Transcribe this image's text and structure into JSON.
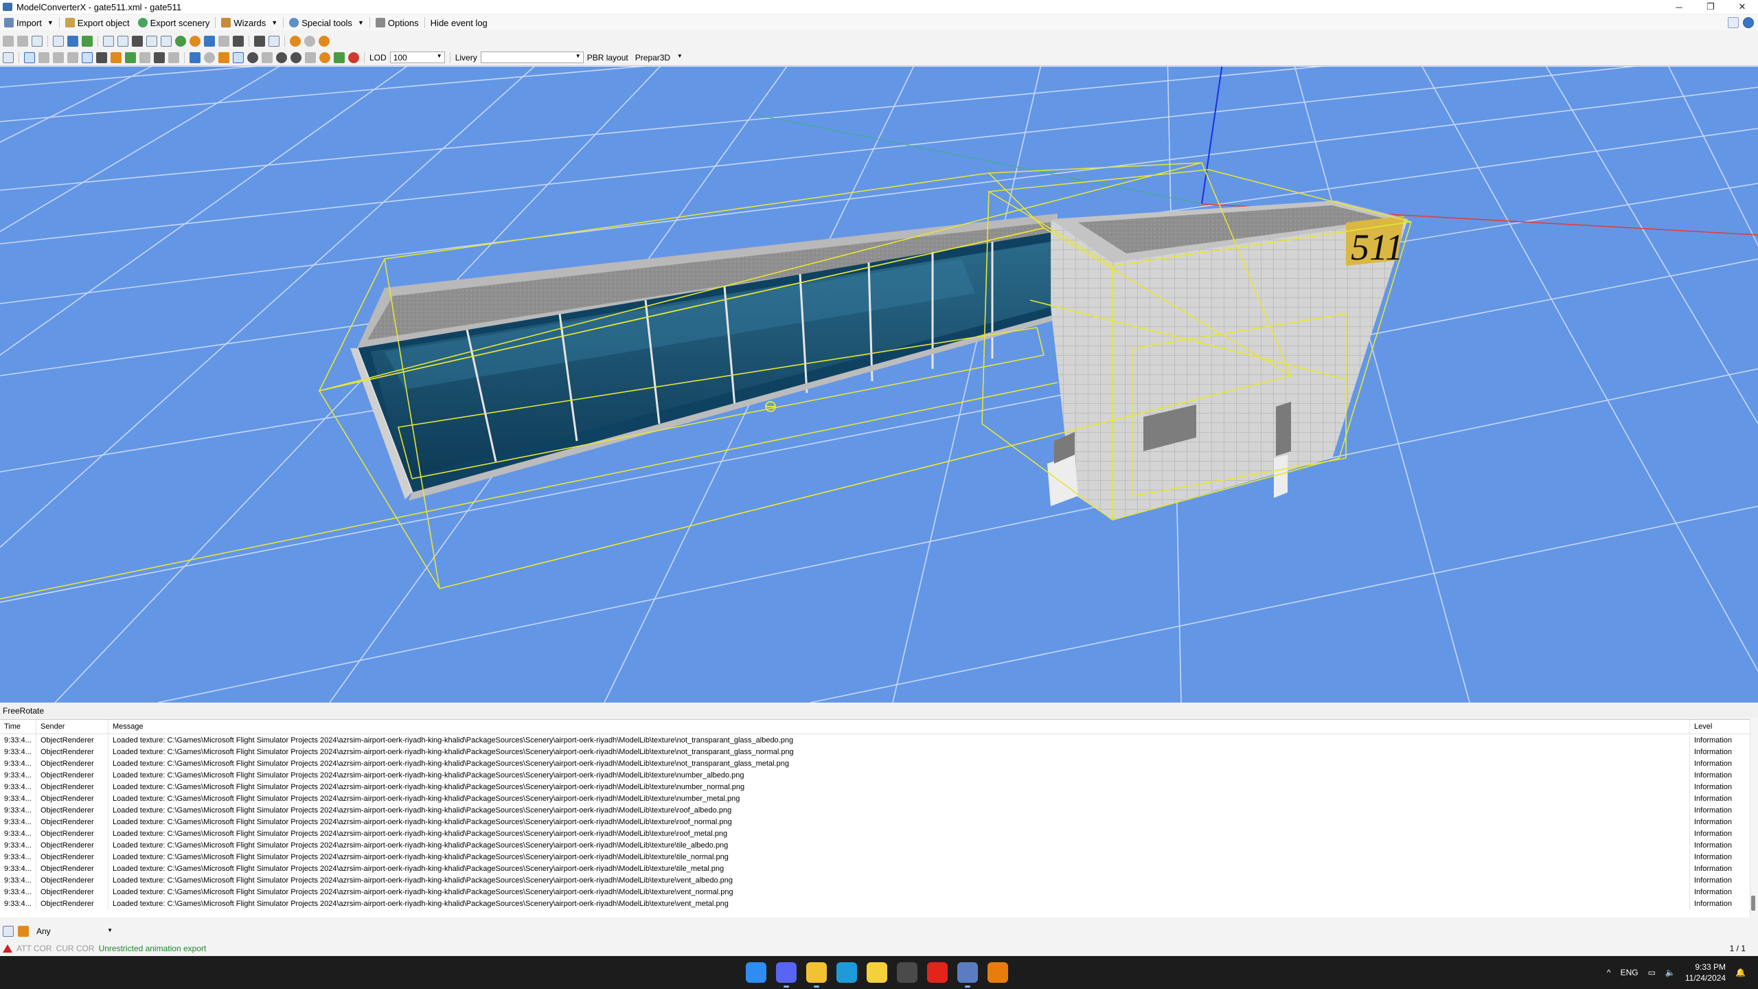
{
  "window": {
    "title": "ModelConverterX - gate511.xml - gate511",
    "controls": [
      "─",
      "❐",
      "✕"
    ]
  },
  "menubar": {
    "items": [
      {
        "label": "Import",
        "icon": "import-icon",
        "has_dropdown": true
      },
      {
        "label": "Export object",
        "icon": "export-object-icon",
        "has_dropdown": false
      },
      {
        "label": "Export scenery",
        "icon": "export-scenery-icon",
        "has_dropdown": false
      },
      {
        "label": "Wizards",
        "icon": "wizard-icon",
        "has_dropdown": true
      },
      {
        "label": "Special tools",
        "icon": "special-tools-icon",
        "has_dropdown": true
      },
      {
        "label": "Options",
        "icon": "options-icon",
        "has_dropdown": false
      },
      {
        "label": "Hide event log",
        "icon": "",
        "has_dropdown": false
      }
    ]
  },
  "toolbar2": {
    "lod_label": "LOD",
    "lod_value": "100",
    "livery_label": "Livery",
    "livery_value": "",
    "pbr_label": "PBR layout",
    "pbr_value": "Prepar3D"
  },
  "viewport": {
    "background_color": "#6496e6",
    "building_number": "511",
    "bbox_color": "#e6e633",
    "grid_color": "#c7d8f5"
  },
  "mode_label": "FreeRotate",
  "eventlog": {
    "columns": [
      "Time",
      "Sender",
      "Message",
      "Level"
    ],
    "rows": [
      {
        "time": "9:33:4...",
        "sender": "ObjectRenderer",
        "message": "Loaded texture: C:\\Games\\Microsoft Flight Simulator Projects 2024\\azrsim-airport-oerk-riyadh-king-khalid\\PackageSources\\Scenery\\airport-oerk-riyadh\\ModelLib\\texture\\not_transparant_glass_albedo.png",
        "level": "Information"
      },
      {
        "time": "9:33:4...",
        "sender": "ObjectRenderer",
        "message": "Loaded texture: C:\\Games\\Microsoft Flight Simulator Projects 2024\\azrsim-airport-oerk-riyadh-king-khalid\\PackageSources\\Scenery\\airport-oerk-riyadh\\ModelLib\\texture\\not_transparant_glass_normal.png",
        "level": "Information"
      },
      {
        "time": "9:33:4...",
        "sender": "ObjectRenderer",
        "message": "Loaded texture: C:\\Games\\Microsoft Flight Simulator Projects 2024\\azrsim-airport-oerk-riyadh-king-khalid\\PackageSources\\Scenery\\airport-oerk-riyadh\\ModelLib\\texture\\not_transparant_glass_metal.png",
        "level": "Information"
      },
      {
        "time": "9:33:4...",
        "sender": "ObjectRenderer",
        "message": "Loaded texture: C:\\Games\\Microsoft Flight Simulator Projects 2024\\azrsim-airport-oerk-riyadh-king-khalid\\PackageSources\\Scenery\\airport-oerk-riyadh\\ModelLib\\texture\\number_albedo.png",
        "level": "Information"
      },
      {
        "time": "9:33:4...",
        "sender": "ObjectRenderer",
        "message": "Loaded texture: C:\\Games\\Microsoft Flight Simulator Projects 2024\\azrsim-airport-oerk-riyadh-king-khalid\\PackageSources\\Scenery\\airport-oerk-riyadh\\ModelLib\\texture\\number_normal.png",
        "level": "Information"
      },
      {
        "time": "9:33:4...",
        "sender": "ObjectRenderer",
        "message": "Loaded texture: C:\\Games\\Microsoft Flight Simulator Projects 2024\\azrsim-airport-oerk-riyadh-king-khalid\\PackageSources\\Scenery\\airport-oerk-riyadh\\ModelLib\\texture\\number_metal.png",
        "level": "Information"
      },
      {
        "time": "9:33:4...",
        "sender": "ObjectRenderer",
        "message": "Loaded texture: C:\\Games\\Microsoft Flight Simulator Projects 2024\\azrsim-airport-oerk-riyadh-king-khalid\\PackageSources\\Scenery\\airport-oerk-riyadh\\ModelLib\\texture\\roof_albedo.png",
        "level": "Information"
      },
      {
        "time": "9:33:4...",
        "sender": "ObjectRenderer",
        "message": "Loaded texture: C:\\Games\\Microsoft Flight Simulator Projects 2024\\azrsim-airport-oerk-riyadh-king-khalid\\PackageSources\\Scenery\\airport-oerk-riyadh\\ModelLib\\texture\\roof_normal.png",
        "level": "Information"
      },
      {
        "time": "9:33:4...",
        "sender": "ObjectRenderer",
        "message": "Loaded texture: C:\\Games\\Microsoft Flight Simulator Projects 2024\\azrsim-airport-oerk-riyadh-king-khalid\\PackageSources\\Scenery\\airport-oerk-riyadh\\ModelLib\\texture\\roof_metal.png",
        "level": "Information"
      },
      {
        "time": "9:33:4...",
        "sender": "ObjectRenderer",
        "message": "Loaded texture: C:\\Games\\Microsoft Flight Simulator Projects 2024\\azrsim-airport-oerk-riyadh-king-khalid\\PackageSources\\Scenery\\airport-oerk-riyadh\\ModelLib\\texture\\tile_albedo.png",
        "level": "Information"
      },
      {
        "time": "9:33:4...",
        "sender": "ObjectRenderer",
        "message": "Loaded texture: C:\\Games\\Microsoft Flight Simulator Projects 2024\\azrsim-airport-oerk-riyadh-king-khalid\\PackageSources\\Scenery\\airport-oerk-riyadh\\ModelLib\\texture\\tile_normal.png",
        "level": "Information"
      },
      {
        "time": "9:33:4...",
        "sender": "ObjectRenderer",
        "message": "Loaded texture: C:\\Games\\Microsoft Flight Simulator Projects 2024\\azrsim-airport-oerk-riyadh-king-khalid\\PackageSources\\Scenery\\airport-oerk-riyadh\\ModelLib\\texture\\tile_metal.png",
        "level": "Information"
      },
      {
        "time": "9:33:4...",
        "sender": "ObjectRenderer",
        "message": "Loaded texture: C:\\Games\\Microsoft Flight Simulator Projects 2024\\azrsim-airport-oerk-riyadh-king-khalid\\PackageSources\\Scenery\\airport-oerk-riyadh\\ModelLib\\texture\\vent_albedo.png",
        "level": "Information"
      },
      {
        "time": "9:33:4...",
        "sender": "ObjectRenderer",
        "message": "Loaded texture: C:\\Games\\Microsoft Flight Simulator Projects 2024\\azrsim-airport-oerk-riyadh-king-khalid\\PackageSources\\Scenery\\airport-oerk-riyadh\\ModelLib\\texture\\vent_normal.png",
        "level": "Information"
      },
      {
        "time": "9:33:4...",
        "sender": "ObjectRenderer",
        "message": "Loaded texture: C:\\Games\\Microsoft Flight Simulator Projects 2024\\azrsim-airport-oerk-riyadh-king-khalid\\PackageSources\\Scenery\\airport-oerk-riyadh\\ModelLib\\texture\\vent_metal.png",
        "level": "Information"
      }
    ]
  },
  "filterbar": {
    "filter_value": "Any"
  },
  "statusbar": {
    "att_cor": "ATT COR",
    "cur_cor": "CUR COR",
    "message": "Unrestricted animation export",
    "message_color": "#1a8a28",
    "pager": "1 / 1"
  },
  "taskbar": {
    "apps": [
      {
        "icon": "windows-start-icon",
        "color": "#2f8cf0"
      },
      {
        "icon": "discord-icon",
        "color": "#5865f2"
      },
      {
        "icon": "file-explorer-icon",
        "color": "#f2c232"
      },
      {
        "icon": "excel-icon",
        "color": "#1d9bd8"
      },
      {
        "icon": "duck-icon",
        "color": "#f4d03a"
      },
      {
        "icon": "steam-icon",
        "color": "#4a4a4a"
      },
      {
        "icon": "opera-icon",
        "color": "#e2251b"
      },
      {
        "icon": "modelconverterx-icon",
        "color": "#5b7cc0"
      },
      {
        "icon": "blender-icon",
        "color": "#e87d0d"
      }
    ],
    "language": "ENG",
    "time": "9:33 PM",
    "date": "11/24/2024"
  }
}
